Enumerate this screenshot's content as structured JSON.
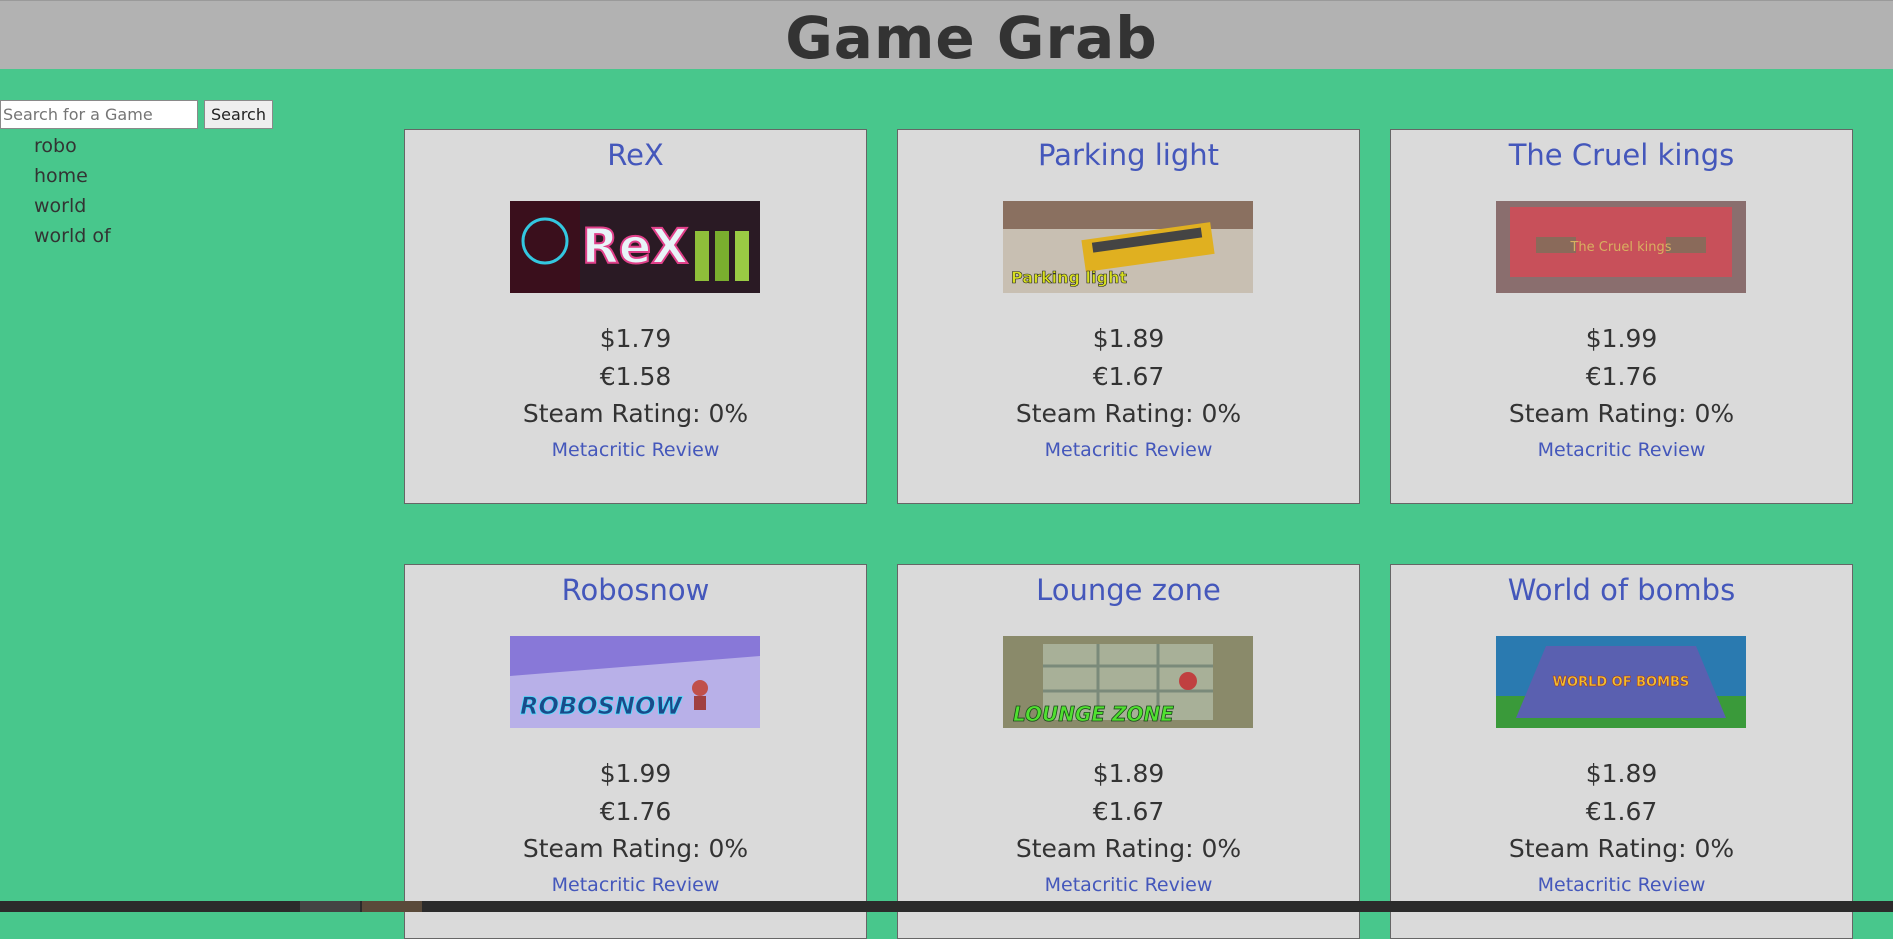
{
  "header": {
    "title": "Game Grab"
  },
  "search": {
    "placeholder": "Search for a Game",
    "value": "",
    "button_label": "Search"
  },
  "suggestions": [
    "robo",
    "home",
    "world",
    "world of"
  ],
  "games": [
    {
      "title": "ReX",
      "thumb_text": "ReX",
      "price_usd": "$1.79",
      "price_eur": "€1.58",
      "rating": "Steam Rating: 0%",
      "review_label": "Metacritic Review"
    },
    {
      "title": "Parking light",
      "thumb_text": "Parking light",
      "price_usd": "$1.89",
      "price_eur": "€1.67",
      "rating": "Steam Rating: 0%",
      "review_label": "Metacritic Review"
    },
    {
      "title": "The Cruel kings",
      "thumb_text": "The Cruel kings",
      "price_usd": "$1.99",
      "price_eur": "€1.76",
      "rating": "Steam Rating: 0%",
      "review_label": "Metacritic Review"
    },
    {
      "title": "Robosnow",
      "thumb_text": "ROBOSNOW",
      "price_usd": "$1.99",
      "price_eur": "€1.76",
      "rating": "Steam Rating: 0%",
      "review_label": "Metacritic Review"
    },
    {
      "title": "Lounge zone",
      "thumb_text": "LOUNGE ZONE",
      "price_usd": "$1.89",
      "price_eur": "€1.67",
      "rating": "Steam Rating: 0%",
      "review_label": "Metacritic Review"
    },
    {
      "title": "World of bombs",
      "thumb_text": "WORLD OF BOMBS",
      "price_usd": "$1.89",
      "price_eur": "€1.67",
      "rating": "Steam Rating: 0%",
      "review_label": "Metacritic Review"
    }
  ],
  "colors": {
    "background": "#48c78c",
    "header": "#b2b2b2",
    "card": "#dadada",
    "link": "#4457bb",
    "text": "#333333"
  }
}
